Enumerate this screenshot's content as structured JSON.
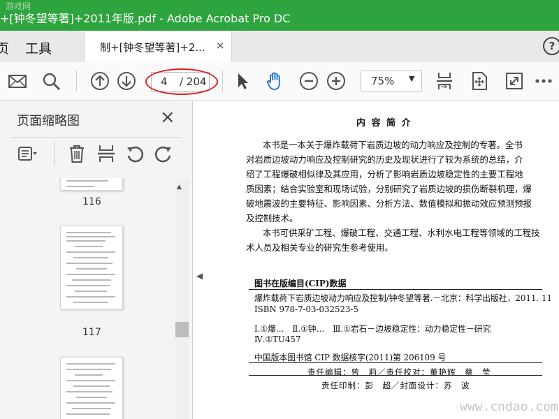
{
  "window": {
    "title": "+[钟冬望等著]+2011年版.pdf - Adobe Acrobat Pro DC"
  },
  "tabs": {
    "home_partial": "页",
    "tools": "工具",
    "doc_tab": "制+[钟冬望等著]+2...",
    "close": "×",
    "help": "?"
  },
  "toolbar": {
    "current_page": "4",
    "total_pages": "/ 204",
    "zoom": "75%",
    "icons": [
      "mail-icon",
      "search-icon",
      "page-up-icon",
      "page-down-icon",
      "select-pointer-icon",
      "hand-tool-icon",
      "zoom-out-icon",
      "zoom-in-icon",
      "fit-page-icon",
      "scroll-mode-icon",
      "fullscreen-icon",
      "more-icon"
    ]
  },
  "left_panel": {
    "title": "页面缩略图",
    "close": "×",
    "thumbnails": [
      {
        "label": "116"
      },
      {
        "label": "117"
      }
    ]
  },
  "document": {
    "heading": "内 容 简 介",
    "body": [
      "本书是一本关于爆炸载荷下岩质边坡的动力响应及控制的专著。全书",
      "对岩质边坡动力响应及控制研究的历史及现状进行了较为系统的总结，介",
      "绍了工程爆破相似律及其应用，分析了影响岩质边坡稳定性的主要工程地",
      "质因素；结合实验室和现场试验，分别研究了岩质边坡的损伤断裂机理，爆",
      "破地震波的主要特征、影响因素、分析方法、数值模拟和振动效应预测预报",
      "及控制技术。"
    ],
    "body2": [
      "本书可供采矿工程、爆破工程、交通工程、水利水电工程等领域的工程技",
      "术人员及相关专业的研究生参考使用。"
    ],
    "cip_heading": "图书在版编目(CIP)数据",
    "cip_lines": [
      "爆炸载荷下岩质边坡动力响应及控制/钟冬望等著.－北京：科学出版社，2011. 11",
      "ISBN 978-7-03-032523-5",
      "Ⅰ.①爆…　Ⅱ.①钟…　Ⅲ.①岩石－边坡稳定性：动力稳定性－研究",
      "Ⅳ.①TU457"
    ],
    "cip_number": "中国版本图书馆 CIP 数据核字(2011)第 206109 号",
    "credits": [
      "责任编辑：曾　莉／责任校对：董艳辉　蔡　莹",
      "责任印制：彭　超／封面设计：苏　波"
    ]
  },
  "overlays": {
    "top_watermark": "游戏网",
    "bottom_watermark": "www.cndao.com"
  }
}
